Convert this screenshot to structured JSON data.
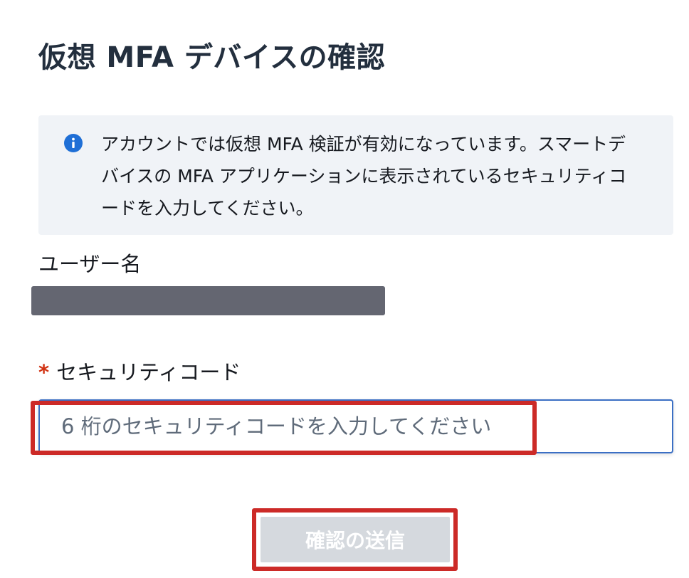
{
  "page": {
    "title": "仮想 MFA デバイスの確認"
  },
  "info": {
    "icon": "info-icon",
    "text": "アカウントでは仮想 MFA 検証が有効になっています。スマートデバイスの MFA アプリケーションに表示されているセキュリティコードを入力してください。",
    "accent_color": "#1f6fd6"
  },
  "username": {
    "label": "ユーザー名",
    "value_redacted": true
  },
  "security_code": {
    "required_mark": "*",
    "label": "セキュリティコード",
    "value": "",
    "placeholder": "6 桁のセキュリティコードを入力してください"
  },
  "submit": {
    "label": "確認の送信",
    "disabled": true
  },
  "colors": {
    "highlight": "#cc2a27",
    "input_border": "#3b6fc4",
    "button_disabled_bg": "#d5d9de",
    "required": "#d13212"
  }
}
